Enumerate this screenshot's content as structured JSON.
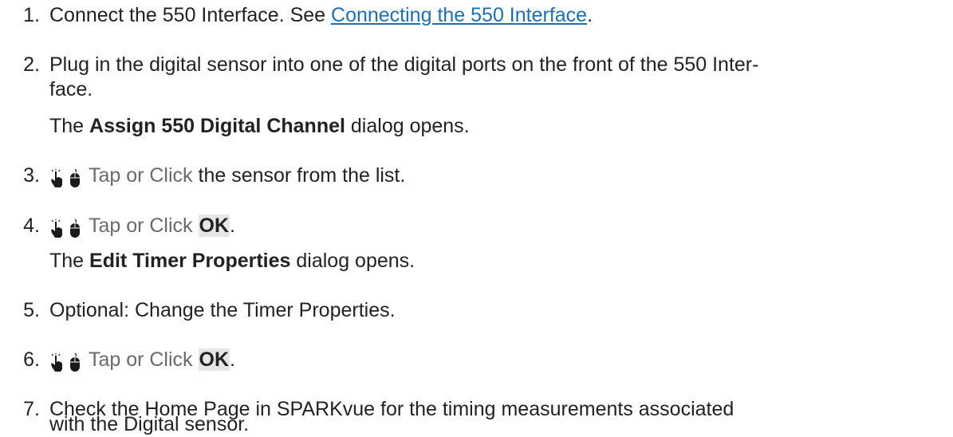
{
  "steps": [
    {
      "number": "1.",
      "prefix": "Connect the 550 Interface. See ",
      "link": "Connecting the 550 Interface",
      "suffix": "."
    },
    {
      "number": "2.",
      "line1": "Plug in the digital sensor into one of the digital ports on the front of the 550 Inter-",
      "line2": "face.",
      "note_bold": "Assign 550 Digital Channel",
      "note_pre": "The ",
      "note_post": " dialog opens."
    },
    {
      "number": "3.",
      "action": "Tap or Click",
      "text": " the sensor from the list."
    },
    {
      "number": "4.",
      "action": "Tap or Click",
      "button": "OK",
      "end": ".",
      "note_pre": "The ",
      "note_bold": "Edit Timer Properties",
      "note_post": " dialog opens."
    },
    {
      "number": "5.",
      "text": "Optional: Change the Timer Properties."
    },
    {
      "number": "6.",
      "action": "Tap or Click",
      "button": "OK",
      "end": "."
    },
    {
      "number": "7.",
      "line1": "Check the Home Page in SPARKvue for the timing measurements associated",
      "line2": "with the Digital sensor."
    }
  ],
  "icons": [
    "tap-hand-icon",
    "mouse-icon"
  ]
}
